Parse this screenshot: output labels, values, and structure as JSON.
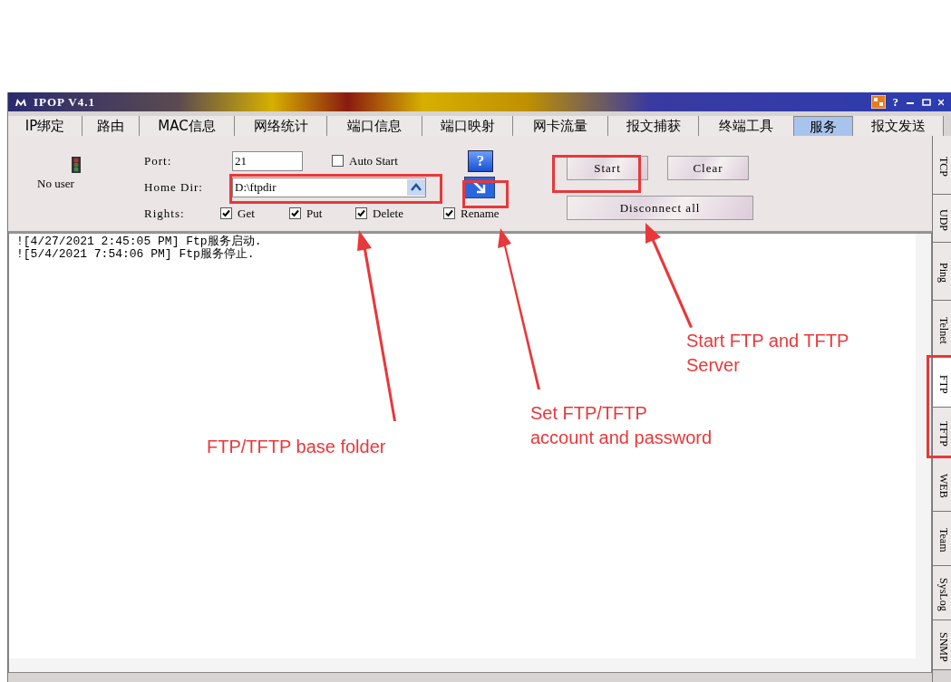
{
  "window": {
    "title": "IPOP V4.1",
    "help_glyph": "?"
  },
  "tabs": [
    {
      "label": "IP绑定",
      "selected": false
    },
    {
      "label": "路由",
      "selected": false
    },
    {
      "label": "MAC信息",
      "selected": false
    },
    {
      "label": "网络统计",
      "selected": false
    },
    {
      "label": "端口信息",
      "selected": false
    },
    {
      "label": "端口映射",
      "selected": false
    },
    {
      "label": "网卡流量",
      "selected": false
    },
    {
      "label": "报文捕获",
      "selected": false
    },
    {
      "label": "终端工具",
      "selected": false
    },
    {
      "label": "服务",
      "selected": true
    },
    {
      "label": "报文发送",
      "selected": false
    }
  ],
  "ftp": {
    "status": "No user",
    "port_label": "Port:",
    "port": "21",
    "auto_start": {
      "label": "Auto Start",
      "checked": false
    },
    "help_button": "?",
    "home_dir_label": "Home Dir:",
    "home_dir": "D:\\ftpdir",
    "rights_label": "Rights:",
    "rights": [
      {
        "label": "Get",
        "checked": true
      },
      {
        "label": "Put",
        "checked": true
      },
      {
        "label": "Delete",
        "checked": true
      },
      {
        "label": "Rename",
        "checked": true
      }
    ],
    "buttons": [
      "Start",
      "Clear",
      "Disconnect all"
    ]
  },
  "log": [
    "![4/27/2021 2:45:05 PM] Ftp服务启动.",
    "![5/4/2021 7:54:06 PM] Ftp服务停止."
  ],
  "side_tabs": [
    {
      "label": "TCP",
      "selected": false
    },
    {
      "label": "UDP",
      "selected": false
    },
    {
      "label": "Ping",
      "selected": false
    },
    {
      "label": "Telnet",
      "selected": false
    },
    {
      "label": "FTP",
      "selected": true
    },
    {
      "label": "TFTP",
      "selected": false
    },
    {
      "label": "WEB",
      "selected": false
    },
    {
      "label": "Team",
      "selected": false
    },
    {
      "label": "SysLog",
      "selected": false
    },
    {
      "label": "SNMP",
      "selected": false
    }
  ],
  "annotations": [
    {
      "lines": [
        "FTP/TFTP base folder"
      ]
    },
    {
      "lines": [
        "Set FTP/TFTP",
        "account and password"
      ]
    },
    {
      "lines": [
        "Start FTP and TFTP",
        "Server"
      ]
    }
  ]
}
